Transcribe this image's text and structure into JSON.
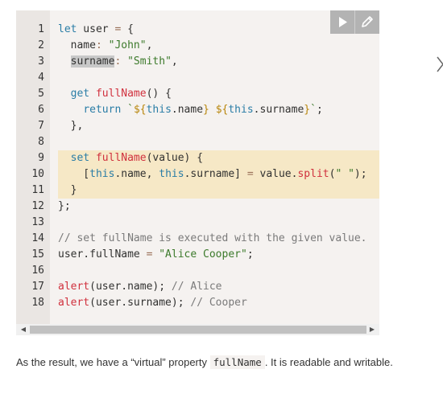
{
  "code": {
    "line_numbers": [
      "1",
      "2",
      "3",
      "4",
      "5",
      "6",
      "7",
      "8",
      "9",
      "10",
      "11",
      "12",
      "13",
      "14",
      "15",
      "16",
      "17",
      "18"
    ],
    "lines": [
      [
        {
          "t": "let",
          "c": "kw"
        },
        {
          "t": " user "
        },
        {
          "t": "=",
          "c": "op"
        },
        {
          "t": " {"
        }
      ],
      [
        {
          "t": "  name"
        },
        {
          "t": ":",
          "c": "op"
        },
        {
          "t": " "
        },
        {
          "t": "\"John\"",
          "c": "str"
        },
        {
          "t": ","
        }
      ],
      [
        {
          "t": "  "
        },
        {
          "t": "surname",
          "c": "sel"
        },
        {
          "t": ":",
          "c": "op"
        },
        {
          "t": " "
        },
        {
          "t": "\"Smith\"",
          "c": "str"
        },
        {
          "t": ","
        }
      ],
      [],
      [
        {
          "t": "  "
        },
        {
          "t": "get",
          "c": "kw"
        },
        {
          "t": " "
        },
        {
          "t": "fullName",
          "c": "fn"
        },
        {
          "t": "() {"
        }
      ],
      [
        {
          "t": "    "
        },
        {
          "t": "return",
          "c": "kw"
        },
        {
          "t": " "
        },
        {
          "t": "`",
          "c": "str"
        },
        {
          "t": "${",
          "c": "interp"
        },
        {
          "t": "this",
          "c": "kw"
        },
        {
          "t": ".name"
        },
        {
          "t": "}",
          "c": "interp"
        },
        {
          "t": " ",
          "c": "str"
        },
        {
          "t": "${",
          "c": "interp"
        },
        {
          "t": "this",
          "c": "kw"
        },
        {
          "t": ".surname"
        },
        {
          "t": "}",
          "c": "interp"
        },
        {
          "t": "`",
          "c": "str"
        },
        {
          "t": ";"
        }
      ],
      [
        {
          "t": "  },"
        }
      ],
      [],
      [
        {
          "t": "  "
        },
        {
          "t": "set",
          "c": "kw"
        },
        {
          "t": " "
        },
        {
          "t": "fullName",
          "c": "fn"
        },
        {
          "t": "(value) {"
        }
      ],
      [
        {
          "t": "    ["
        },
        {
          "t": "this",
          "c": "kw"
        },
        {
          "t": ".name, "
        },
        {
          "t": "this",
          "c": "kw"
        },
        {
          "t": ".surname] "
        },
        {
          "t": "=",
          "c": "op"
        },
        {
          "t": " value."
        },
        {
          "t": "split",
          "c": "fn"
        },
        {
          "t": "("
        },
        {
          "t": "\" \"",
          "c": "str"
        },
        {
          "t": ");"
        }
      ],
      [
        {
          "t": "  }"
        }
      ],
      [
        {
          "t": "};"
        }
      ],
      [],
      [
        {
          "t": "// set fullName is executed with the given value.",
          "c": "com"
        }
      ],
      [
        {
          "t": "user.fullName "
        },
        {
          "t": "=",
          "c": "op"
        },
        {
          "t": " "
        },
        {
          "t": "\"Alice Cooper\"",
          "c": "str"
        },
        {
          "t": ";"
        }
      ],
      [],
      [
        {
          "t": "alert",
          "c": "fn"
        },
        {
          "t": "(user.name); "
        },
        {
          "t": "// Alice",
          "c": "com"
        }
      ],
      [
        {
          "t": "alert",
          "c": "fn"
        },
        {
          "t": "(user.surname); "
        },
        {
          "t": "// Cooper",
          "c": "com"
        }
      ]
    ],
    "highlighted_lines": [
      9,
      10,
      11
    ]
  },
  "toolbar": {
    "run_icon": "play-icon",
    "edit_icon": "edit-icon"
  },
  "scrollbar": {
    "left_arrow": "◀",
    "right_arrow": "▶"
  },
  "paragraph": {
    "before": "As the result, we have a “virtual” property ",
    "code": "fullName",
    "after": ". It is readable and writable."
  },
  "colors": {
    "panel_bg": "#f5f2f0",
    "gutter_bg": "#eae6e3",
    "highlight_bg": "#f6e8c6",
    "button_bg": "#b3b3b3",
    "keyword": "#2a7da6",
    "string": "#3c7a2b",
    "function": "#d0303d"
  }
}
